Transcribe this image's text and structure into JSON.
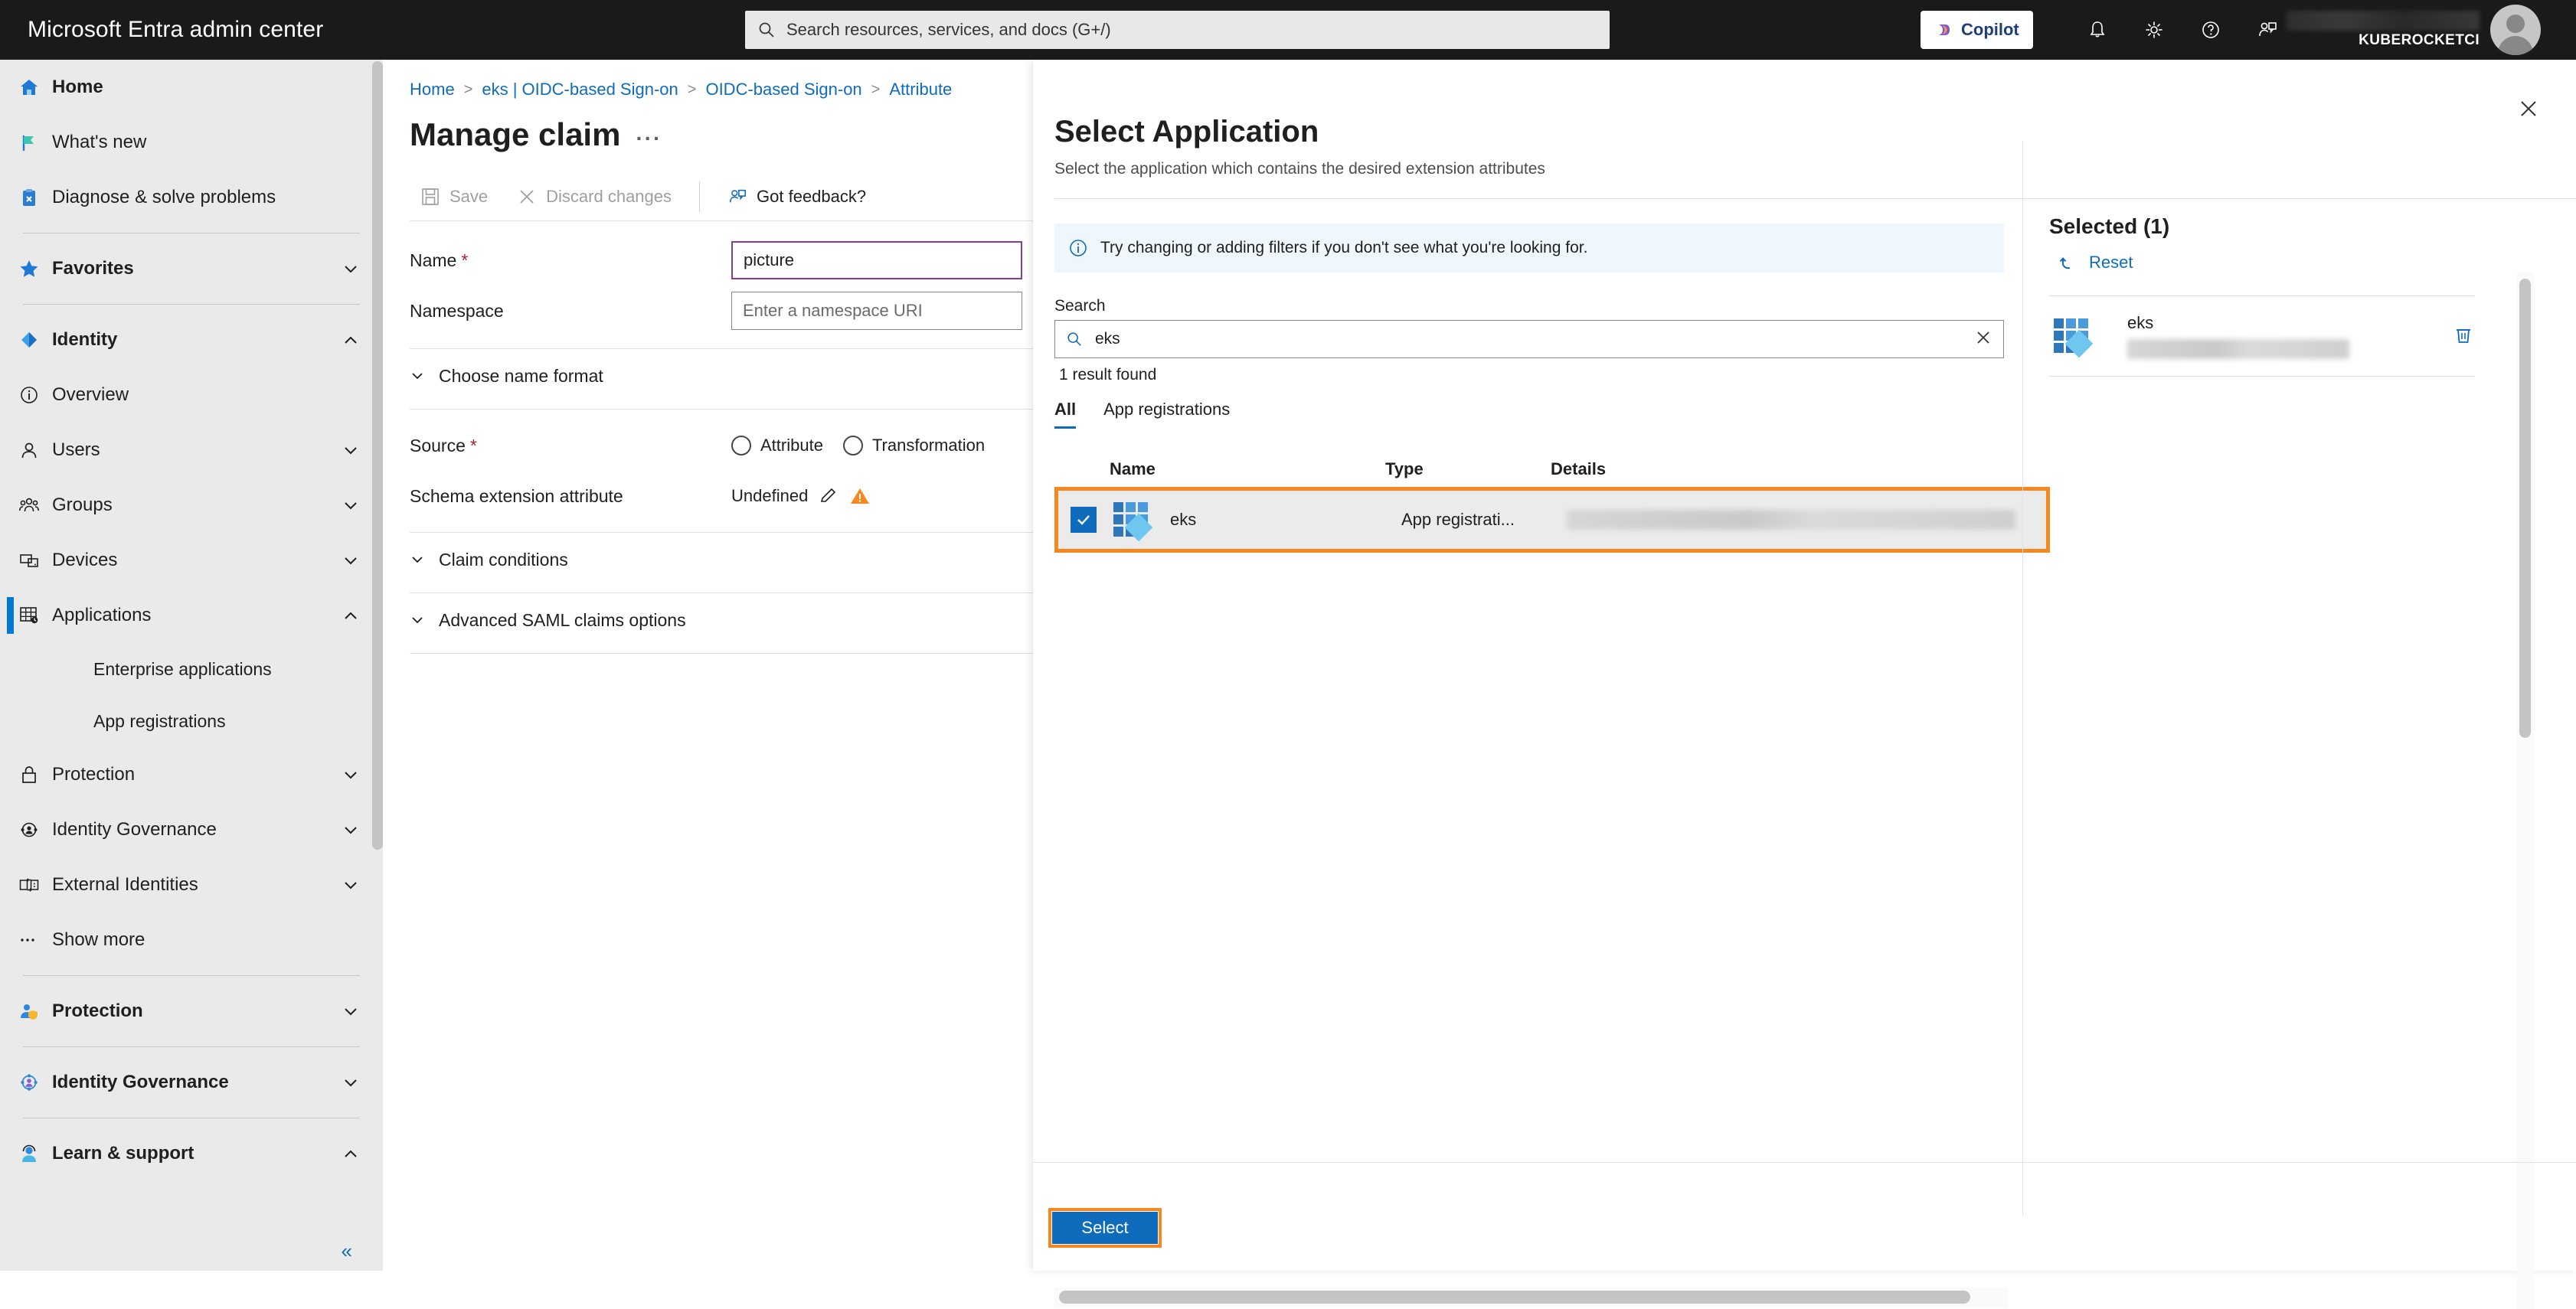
{
  "topbar": {
    "brand": "Microsoft Entra admin center",
    "search_placeholder": "Search resources, services, and docs (G+/)",
    "copilot_label": "Copilot",
    "tenant_name": "KUBEROCKETCI",
    "icons": [
      "search-icon",
      "bell-icon",
      "gear-icon",
      "help-icon",
      "feedback-icon",
      "avatar"
    ]
  },
  "sidebar": {
    "items": [
      {
        "label": "Home",
        "icon": "home-icon",
        "bold": true,
        "chevron": "",
        "sub": false,
        "selected": false
      },
      {
        "label": "What's new",
        "icon": "flag-icon",
        "bold": false,
        "chevron": "",
        "sub": false,
        "selected": false
      },
      {
        "label": "Diagnose & solve problems",
        "icon": "diagnose-icon",
        "bold": false,
        "chevron": "",
        "sub": false,
        "selected": false
      },
      {
        "label": "Favorites",
        "icon": "star-icon",
        "bold": true,
        "chevron": "down",
        "sub": false,
        "selected": false
      },
      {
        "label": "Identity",
        "icon": "identity-icon",
        "bold": true,
        "chevron": "up",
        "sub": false,
        "selected": false
      },
      {
        "label": "Overview",
        "icon": "info-icon",
        "bold": false,
        "chevron": "",
        "sub": false,
        "selected": false
      },
      {
        "label": "Users",
        "icon": "user-icon",
        "bold": false,
        "chevron": "down",
        "sub": false,
        "selected": false
      },
      {
        "label": "Groups",
        "icon": "groups-icon",
        "bold": false,
        "chevron": "down",
        "sub": false,
        "selected": false
      },
      {
        "label": "Devices",
        "icon": "devices-icon",
        "bold": false,
        "chevron": "down",
        "sub": false,
        "selected": false
      },
      {
        "label": "Applications",
        "icon": "applications-icon",
        "bold": false,
        "chevron": "up",
        "sub": false,
        "selected": true
      },
      {
        "label": "Enterprise applications",
        "icon": "",
        "bold": false,
        "chevron": "",
        "sub": true,
        "selected": false
      },
      {
        "label": "App registrations",
        "icon": "",
        "bold": false,
        "chevron": "",
        "sub": true,
        "selected": false
      },
      {
        "label": "Protection",
        "icon": "lock-icon",
        "bold": false,
        "chevron": "down",
        "sub": false,
        "selected": false
      },
      {
        "label": "Identity Governance",
        "icon": "governance-icon",
        "bold": false,
        "chevron": "down",
        "sub": false,
        "selected": false
      },
      {
        "label": "External Identities",
        "icon": "external-identities-icon",
        "bold": false,
        "chevron": "down",
        "sub": false,
        "selected": false
      },
      {
        "label": "Show more",
        "icon": "ellipsis-icon",
        "bold": false,
        "chevron": "",
        "sub": false,
        "selected": false
      },
      {
        "label": "Protection",
        "icon": "protection-shield-icon",
        "bold": true,
        "chevron": "down",
        "sub": false,
        "selected": false
      },
      {
        "label": "Identity Governance",
        "icon": "identity-governance-color-icon",
        "bold": true,
        "chevron": "down",
        "sub": false,
        "selected": false
      },
      {
        "label": "Learn & support",
        "icon": "support-icon",
        "bold": true,
        "chevron": "up",
        "sub": false,
        "selected": false
      }
    ],
    "collapse_label": "«"
  },
  "main": {
    "breadcrumb": [
      "Home",
      "eks | OIDC-based Sign-on",
      "OIDC-based Sign-on",
      "Attribute"
    ],
    "title": "Manage claim",
    "title_overflow": "···",
    "commands": {
      "save": "Save",
      "discard": "Discard changes",
      "feedback": "Got feedback?"
    },
    "fields": {
      "name_label": "Name",
      "name_value": "picture",
      "namespace_label": "Namespace",
      "namespace_placeholder": "Enter a namespace URI",
      "choose_name_format": "Choose name format",
      "source_label": "Source",
      "source_options": [
        "Attribute",
        "Transformation"
      ],
      "schema_label": "Schema extension attribute",
      "schema_value": "Undefined",
      "claim_conditions": "Claim conditions",
      "advanced_saml": "Advanced SAML claims options"
    }
  },
  "panel": {
    "title": "Select Application",
    "subtitle": "Select the application which contains the desired extension attributes",
    "info_message": "Try changing or adding filters if you don't see what you're looking for.",
    "search_label": "Search",
    "search_value": "eks",
    "result_count": "1 result found",
    "tabs": [
      {
        "label": "All",
        "active": true
      },
      {
        "label": "App registrations",
        "active": false
      }
    ],
    "table": {
      "columns": [
        "Name",
        "Type",
        "Details"
      ],
      "rows": [
        {
          "checked": true,
          "name": "eks",
          "type": "App registrati...",
          "details": ""
        }
      ]
    },
    "select_button": "Select",
    "selected": {
      "heading": "Selected (1)",
      "reset_label": "Reset",
      "items": [
        {
          "name": "eks",
          "detail": ""
        }
      ]
    }
  },
  "colors": {
    "accent": "#0f6cbd",
    "highlight": "#f7871f",
    "topbar_bg": "#1b1a19",
    "field_focus": "#8a3b94",
    "warning": "#f7871f",
    "required": "#a4262c"
  }
}
